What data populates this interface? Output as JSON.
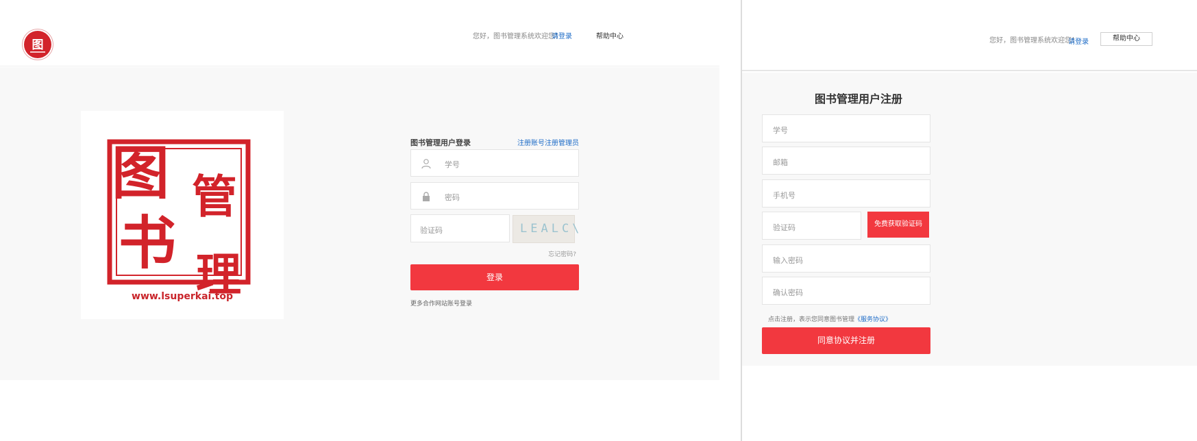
{
  "login_page": {
    "logo_char": "图",
    "header": {
      "greeting": "您好，图书管理系统欢迎您！",
      "login_link": "请登录",
      "help": "帮助中心"
    },
    "seal": {
      "char_1": "图",
      "char_2": "书",
      "char_3": "管",
      "char_4": "理",
      "url": "www.lsuperkai.top",
      "color": "#d2232a"
    },
    "form": {
      "title": "图书管理用户登录",
      "register_link": "注册账号注册管理员",
      "username_placeholder": "学号",
      "password_placeholder": "密码",
      "captcha_placeholder": "验证码",
      "captcha_text": "LEALC\\",
      "forgot": "忘记密码?",
      "submit": "登录",
      "more": "更多合作网站账号登录"
    }
  },
  "register_page": {
    "header": {
      "greeting": "您好，图书管理系统欢迎您！",
      "login_link": "请登录",
      "help": "帮助中心"
    },
    "title": "图书管理用户注册",
    "fields": {
      "student_id": "学号",
      "email": "邮箱",
      "phone": "手机号",
      "captcha": "验证码",
      "password": "输入密码",
      "confirm": "确认密码"
    },
    "sms_button": "免费获取验证码",
    "agreement_prefix": "点击注册，表示您同意图书管理",
    "agreement_link": "《服务协议》",
    "submit": "同意协议并注册"
  },
  "colors": {
    "accent": "#f2383f",
    "link": "#1e6cc7",
    "seal_red": "#d2232a"
  }
}
